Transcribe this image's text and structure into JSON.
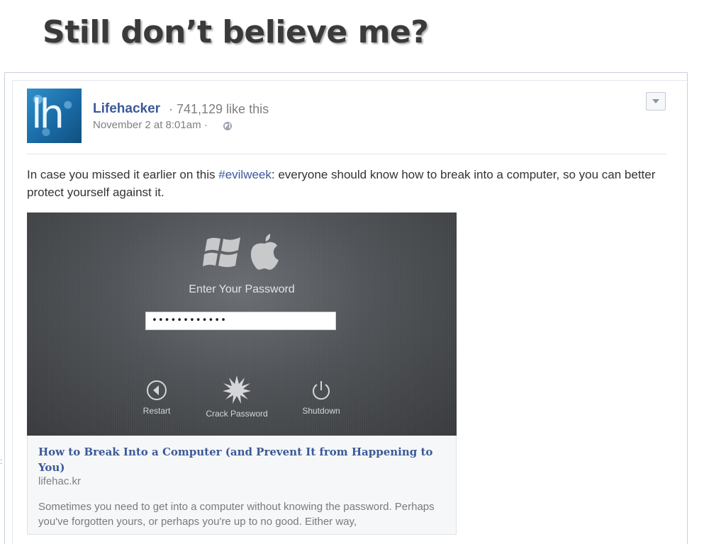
{
  "slide": {
    "title": "Still don’t believe me?"
  },
  "left_mark": ":",
  "post": {
    "avatar_text": "lh",
    "page_name": "Lifehacker",
    "likes": " · 741,129 like this",
    "timestamp": "November 2 at 8:01am ·",
    "icons": {
      "privacy": "globe-icon",
      "menu": "chevron-down-icon"
    },
    "text": {
      "before": "In case you missed it earlier on this ",
      "hashtag": "#evilweek",
      "after": ": everyone should know how to break into a computer, so you can better protect yourself against it."
    },
    "media": {
      "password_label": "Enter Your Password",
      "password_value": "••••••••••••",
      "controls": {
        "restart": "Restart",
        "crack": "Crack Password",
        "shutdown": "Shutdown"
      },
      "icons": [
        "windows-logo-icon",
        "apple-logo-icon",
        "restart-icon",
        "crack-starburst-icon",
        "power-icon"
      ]
    },
    "link": {
      "title": "How to Break Into a Computer (and Prevent It from Happening to You)",
      "domain": "lifehac.kr",
      "description": "Sometimes you need to get into a computer without knowing the password. Perhaps you've forgotten yours, or perhaps you're up to no good. Either way,"
    },
    "colors": {
      "link_blue": "#3b5998",
      "muted_gray": "#7f7f7f",
      "text": "#333333"
    }
  }
}
